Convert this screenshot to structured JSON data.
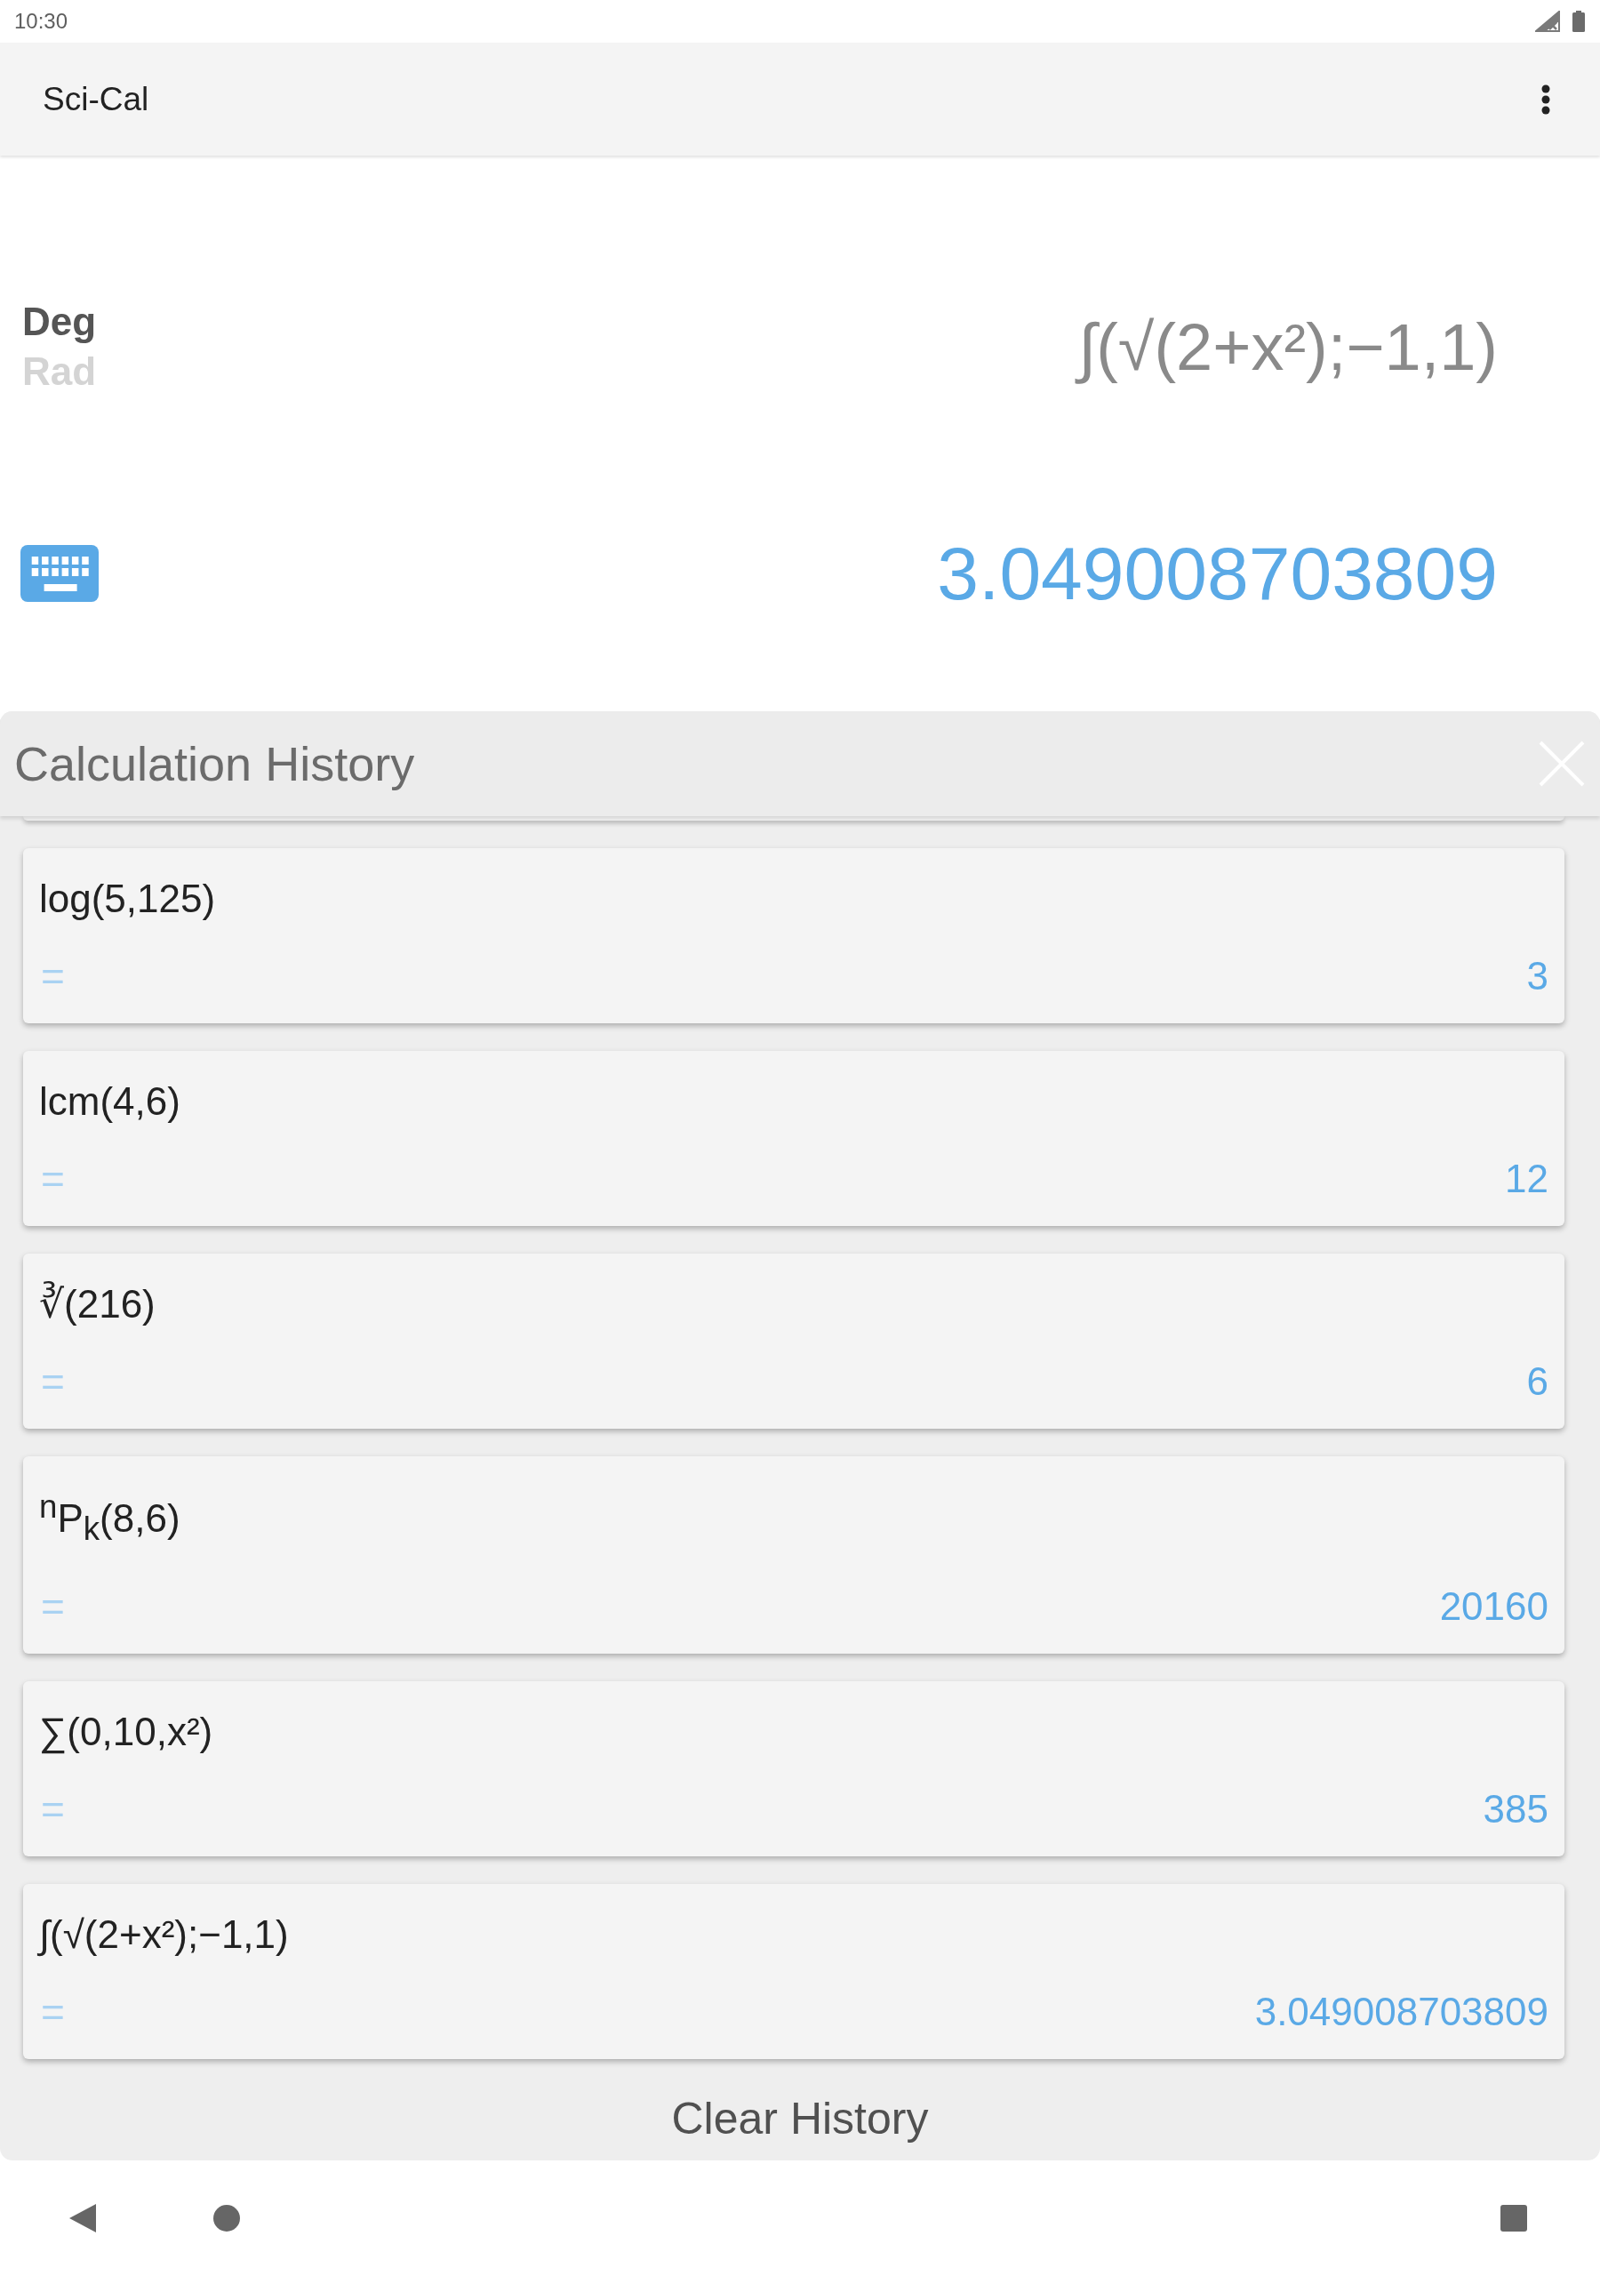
{
  "status_bar": {
    "time": "10:30"
  },
  "app_bar": {
    "title": "Sci-Cal"
  },
  "calculator": {
    "angle_modes": [
      {
        "label": "Deg",
        "selected": true
      },
      {
        "label": "Rad",
        "selected": false
      }
    ],
    "expression": "∫(√(2+x²);−1,1)",
    "result": "3.049008703809"
  },
  "history": {
    "title": "Calculation History",
    "entries": [
      {
        "expression": "log(5,125)",
        "equals": "=",
        "result": "3"
      },
      {
        "expression": "lcm(4,6)",
        "equals": "=",
        "result": "12"
      },
      {
        "expression": "∛(216)",
        "equals": "=",
        "result": "6"
      },
      {
        "expression": "$^{n}$P$_{k}$(8,6)",
        "equals": "=",
        "result": "20160"
      },
      {
        "expression": "∑(0,10,x²)",
        "equals": "=",
        "result": "385"
      },
      {
        "expression": "∫(√(2+x²);−1,1)",
        "equals": "=",
        "result": "3.049008703809"
      }
    ],
    "clear_button": "Clear History"
  }
}
